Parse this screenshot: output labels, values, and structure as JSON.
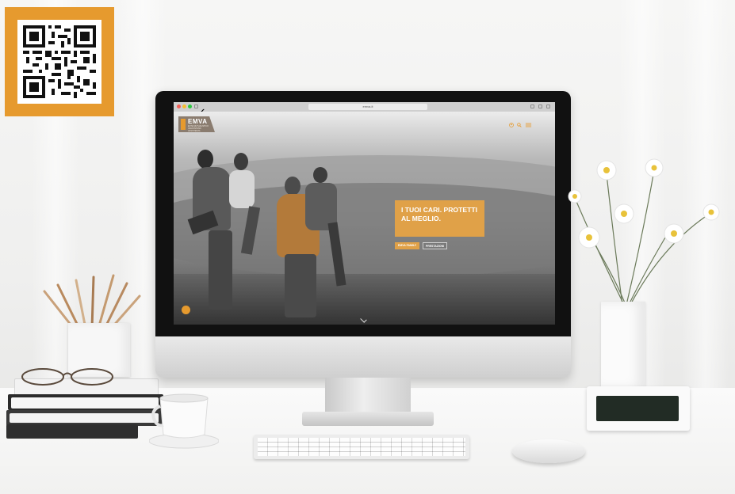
{
  "qr_badge": {
    "accent_color": "#e69a2e",
    "icon": "qr-code-icon"
  },
  "website": {
    "browser": {
      "url_text": "emva.it",
      "window_dots": [
        "#f25f57",
        "#f6be2f",
        "#2cc840"
      ]
    },
    "logo": {
      "name": "EMVA",
      "tagline": "ENTE MUTUALISTICO VALDOSTANO ASSISTENZA"
    },
    "header_icons": [
      "user-icon",
      "search-icon",
      "menu-icon"
    ],
    "hero": {
      "title": "I TUOI CARI. PROTETTI AL MEGLIO.",
      "primary_button": "EMVA FAMILY",
      "secondary_button": "PRESTAZIONI"
    },
    "chat_icon": "chat-icon",
    "scroll_icon": "chevron-down-icon",
    "accent_color": "#e0a148"
  }
}
